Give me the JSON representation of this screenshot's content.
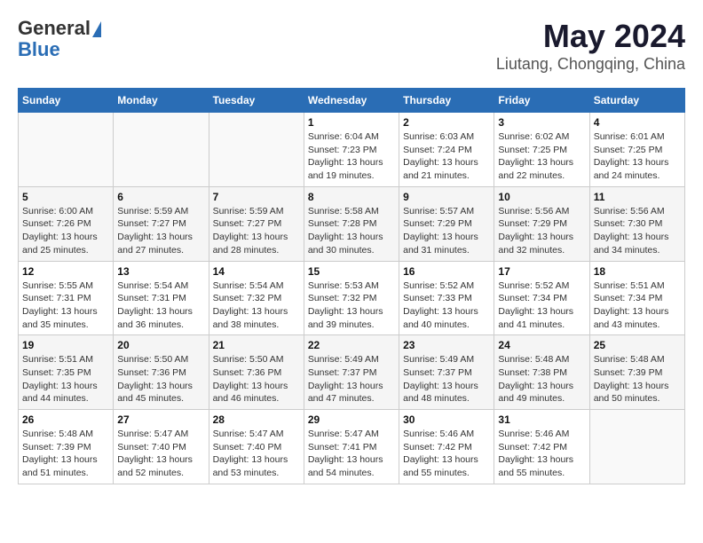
{
  "header": {
    "logo_general": "General",
    "logo_blue": "Blue",
    "title": "May 2024",
    "subtitle": "Liutang, Chongqing, China"
  },
  "weekdays": [
    "Sunday",
    "Monday",
    "Tuesday",
    "Wednesday",
    "Thursday",
    "Friday",
    "Saturday"
  ],
  "weeks": [
    [
      {
        "day": "",
        "info": ""
      },
      {
        "day": "",
        "info": ""
      },
      {
        "day": "",
        "info": ""
      },
      {
        "day": "1",
        "info": "Sunrise: 6:04 AM\nSunset: 7:23 PM\nDaylight: 13 hours\nand 19 minutes."
      },
      {
        "day": "2",
        "info": "Sunrise: 6:03 AM\nSunset: 7:24 PM\nDaylight: 13 hours\nand 21 minutes."
      },
      {
        "day": "3",
        "info": "Sunrise: 6:02 AM\nSunset: 7:25 PM\nDaylight: 13 hours\nand 22 minutes."
      },
      {
        "day": "4",
        "info": "Sunrise: 6:01 AM\nSunset: 7:25 PM\nDaylight: 13 hours\nand 24 minutes."
      }
    ],
    [
      {
        "day": "5",
        "info": "Sunrise: 6:00 AM\nSunset: 7:26 PM\nDaylight: 13 hours\nand 25 minutes."
      },
      {
        "day": "6",
        "info": "Sunrise: 5:59 AM\nSunset: 7:27 PM\nDaylight: 13 hours\nand 27 minutes."
      },
      {
        "day": "7",
        "info": "Sunrise: 5:59 AM\nSunset: 7:27 PM\nDaylight: 13 hours\nand 28 minutes."
      },
      {
        "day": "8",
        "info": "Sunrise: 5:58 AM\nSunset: 7:28 PM\nDaylight: 13 hours\nand 30 minutes."
      },
      {
        "day": "9",
        "info": "Sunrise: 5:57 AM\nSunset: 7:29 PM\nDaylight: 13 hours\nand 31 minutes."
      },
      {
        "day": "10",
        "info": "Sunrise: 5:56 AM\nSunset: 7:29 PM\nDaylight: 13 hours\nand 32 minutes."
      },
      {
        "day": "11",
        "info": "Sunrise: 5:56 AM\nSunset: 7:30 PM\nDaylight: 13 hours\nand 34 minutes."
      }
    ],
    [
      {
        "day": "12",
        "info": "Sunrise: 5:55 AM\nSunset: 7:31 PM\nDaylight: 13 hours\nand 35 minutes."
      },
      {
        "day": "13",
        "info": "Sunrise: 5:54 AM\nSunset: 7:31 PM\nDaylight: 13 hours\nand 36 minutes."
      },
      {
        "day": "14",
        "info": "Sunrise: 5:54 AM\nSunset: 7:32 PM\nDaylight: 13 hours\nand 38 minutes."
      },
      {
        "day": "15",
        "info": "Sunrise: 5:53 AM\nSunset: 7:32 PM\nDaylight: 13 hours\nand 39 minutes."
      },
      {
        "day": "16",
        "info": "Sunrise: 5:52 AM\nSunset: 7:33 PM\nDaylight: 13 hours\nand 40 minutes."
      },
      {
        "day": "17",
        "info": "Sunrise: 5:52 AM\nSunset: 7:34 PM\nDaylight: 13 hours\nand 41 minutes."
      },
      {
        "day": "18",
        "info": "Sunrise: 5:51 AM\nSunset: 7:34 PM\nDaylight: 13 hours\nand 43 minutes."
      }
    ],
    [
      {
        "day": "19",
        "info": "Sunrise: 5:51 AM\nSunset: 7:35 PM\nDaylight: 13 hours\nand 44 minutes."
      },
      {
        "day": "20",
        "info": "Sunrise: 5:50 AM\nSunset: 7:36 PM\nDaylight: 13 hours\nand 45 minutes."
      },
      {
        "day": "21",
        "info": "Sunrise: 5:50 AM\nSunset: 7:36 PM\nDaylight: 13 hours\nand 46 minutes."
      },
      {
        "day": "22",
        "info": "Sunrise: 5:49 AM\nSunset: 7:37 PM\nDaylight: 13 hours\nand 47 minutes."
      },
      {
        "day": "23",
        "info": "Sunrise: 5:49 AM\nSunset: 7:37 PM\nDaylight: 13 hours\nand 48 minutes."
      },
      {
        "day": "24",
        "info": "Sunrise: 5:48 AM\nSunset: 7:38 PM\nDaylight: 13 hours\nand 49 minutes."
      },
      {
        "day": "25",
        "info": "Sunrise: 5:48 AM\nSunset: 7:39 PM\nDaylight: 13 hours\nand 50 minutes."
      }
    ],
    [
      {
        "day": "26",
        "info": "Sunrise: 5:48 AM\nSunset: 7:39 PM\nDaylight: 13 hours\nand 51 minutes."
      },
      {
        "day": "27",
        "info": "Sunrise: 5:47 AM\nSunset: 7:40 PM\nDaylight: 13 hours\nand 52 minutes."
      },
      {
        "day": "28",
        "info": "Sunrise: 5:47 AM\nSunset: 7:40 PM\nDaylight: 13 hours\nand 53 minutes."
      },
      {
        "day": "29",
        "info": "Sunrise: 5:47 AM\nSunset: 7:41 PM\nDaylight: 13 hours\nand 54 minutes."
      },
      {
        "day": "30",
        "info": "Sunrise: 5:46 AM\nSunset: 7:42 PM\nDaylight: 13 hours\nand 55 minutes."
      },
      {
        "day": "31",
        "info": "Sunrise: 5:46 AM\nSunset: 7:42 PM\nDaylight: 13 hours\nand 55 minutes."
      },
      {
        "day": "",
        "info": ""
      }
    ]
  ]
}
